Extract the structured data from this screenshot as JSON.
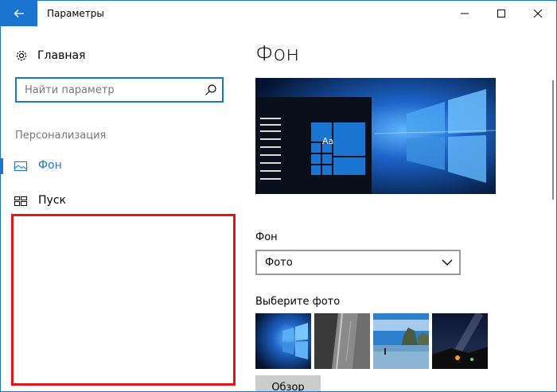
{
  "window": {
    "title": "Параметры"
  },
  "sidebar": {
    "home_label": "Главная",
    "search_placeholder": "Найти параметр",
    "section_label": "Персонализация",
    "items": [
      {
        "label": "Фон",
        "icon": "picture-icon",
        "selected": true
      },
      {
        "label": "Пуск",
        "icon": "start-icon",
        "selected": false
      }
    ]
  },
  "main": {
    "title": "Фон",
    "preview_tile_text": "Aa",
    "background_label": "Фон",
    "background_value": "Фото",
    "choose_photo_label": "Выберите фото",
    "browse_label": "Обзор"
  },
  "colors": {
    "accent": "#1a75d2",
    "highlight": "#e8121b"
  }
}
